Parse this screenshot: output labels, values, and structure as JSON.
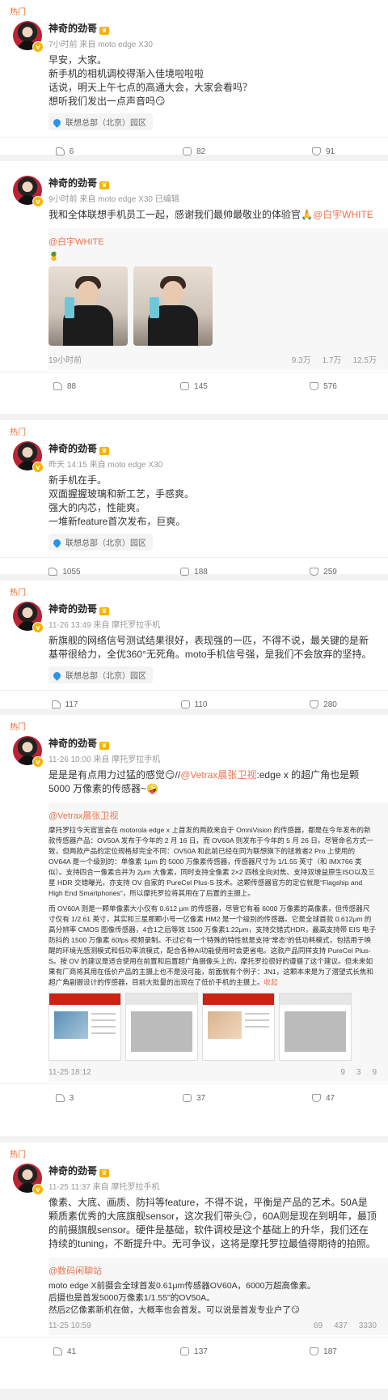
{
  "posts": [
    {
      "hot": "热门",
      "name": "神奇的劲哥",
      "meta": "7小时前 来自 moto edge X30",
      "text": [
        "早安，大家。",
        "新手机的相机调校得渐入佳境啦啦啦",
        "话说，明天上午七点的高通大会，大家会看吗？",
        "想听我们发出一点声音吗😏"
      ],
      "location": "联想总部（北京）园区",
      "shares": "6",
      "comments": "82",
      "likes": "91"
    },
    {
      "hot": "",
      "name": "神奇的劲哥",
      "meta": "9小时前 来自 moto edge X30 已编辑",
      "text_prefix": "我和全体联想手机员工一起，感谢我们最帅最敬业的体验官🙏",
      "text_link": "@白宇WHITE",
      "repost": {
        "name": "@白宇WHITE",
        "text": "🍍",
        "time": "19小时前",
        "shares": "9.3万",
        "comments": "1.7万",
        "likes": "12.5万"
      },
      "shares": "88",
      "comments": "145",
      "likes": "576"
    },
    {
      "hot": "热门",
      "name": "神奇的劲哥",
      "meta": "昨天 14:15 来自 moto edge X30",
      "text": [
        "新手机在手。",
        "双面握握玻璃和新工艺，手感爽。",
        "强大的内芯，性能爽。",
        "一堆新feature首次发布，巨爽。"
      ],
      "location": "联想总部（北京）园区",
      "shares": "1055",
      "comments": "188",
      "likes": "259"
    },
    {
      "hot": "热门",
      "name": "神奇的劲哥",
      "meta": "11-26 13:49 来自 摩托罗拉手机",
      "text": [
        "新旗舰的网络信号测试结果很好，表现强的一匹，不得不说，最关键的是新基带很给力，全优360°无死角。moto手机信号强，是我们不会放弃的坚持。"
      ],
      "location": "联想总部（北京）园区",
      "shares": "117",
      "comments": "110",
      "likes": "280"
    },
    {
      "hot": "热门",
      "name": "神奇的劲哥",
      "meta": "11-26 10:00 来自 摩托罗拉手机",
      "text_prefix": "是是是有点用力过猛的感觉😏//",
      "text_link": "@Vetrax晨张卫视",
      "text_suffix": ":edge x 的超广角也是颗 5000 万像素的传感器~🤪",
      "repost": {
        "name": "@Vetrax晨张卫视",
        "text": "摩托罗拉今天官宣会在 motorola edge x 上首发的两款来自于 OmniVision 的传感器，都是在今年发布的新款传感器产品：OV50A 发布于今年的 2 月 16 日，而 OV60A 则发布于今年的 5 月 26 日。尽管命名方式一致，但两款产品的定位规格却完全不同：OV50A 和此前已经在同为联想旗下的拯救者2 Pro 上使用的 OV64A 是一个级别的：单像素 1μm 的 5000 万像素传感器，传感器尺寸为 1/1.55 英寸（和 IMX766 类似）。支持四合一像素合并为 2μm 大像素，同时支持全像素 2×2 四核全向对焦、支持双增益原生ISO以及三星 HDR 交错曝光，亦支持 OV 自家的 PureCel Plus-S 技术。这颗传感器官方的定位就是“Flagship and High End Smartphones”，所以摩托罗拉将其用在了后置的主摄上。",
        "text2": "而 OV60A 则是一颗单像素大小仅有 0.612 μm 的传感器，尽管它有着 6000 万像素的高像素，但传感器尺寸仅有 1/2.61 英寸，其实和三星那颗小号一亿像素 HM2 是一个级别的传感器。它是全球首款 0.612μm 的高分辨率 CMOS 图像传感器，4合1之后等效 1500 万像素1.22μm，支持交错式HDR，最高支持带 EIS 电子防抖的 1500 万像素 60fps 视频录制。不过它有一个特殊的特性就是支持“常态”的低功耗模式，包括用于唤醒的环境光感测模式和低功率流模式，配合各种AI功能使用时会更省电。这款产品同样支持 PureCel Plus-S。按 OV 的建议是适合使用在前置和后置超广角摄像头上的，摩托罗拉很好的遵循了这个建议。但未来如果有厂商将其用在低价产品的主摄上也不是没可能，前面就有个例子：JN1，这颗本来是为了潜望式长焦和超广角副摄设计的传感器，目前大批量的出现在了低价手机的主摄上。",
        "fold": "收起",
        "time": "11-25 18:12",
        "shares": "9",
        "comments": "3",
        "likes": "9"
      },
      "shares": "3",
      "comments": "37",
      "likes": "47"
    },
    {
      "hot": "热门",
      "name": "神奇的劲哥",
      "meta": "11-25 11:37 来自 摩托罗拉手机",
      "text": [
        "像素、大底、画质、防抖等feature，不得不说，平衡是产品的艺术。50A是颗质素优秀的大底旗舰sensor，这次我们带头😏，60A则是现在到明年，最顶的前摄旗舰sensor。硬件是基础，软件调校是这个基础上的升华，我们还在持续的tuning，不断提升中。无可争议，这将是摩托罗拉最值得期待的拍照。"
      ],
      "repost": {
        "name": "@数码闲聊站",
        "text": "moto edge X前摄会全球首发0.61μm传感器OV60A，6000万超高像素。",
        "text2": "后摄也是首发5000万像素1/1.55\"的OV50A。",
        "text3": "然后2亿像素新机在做，大概率也会首发。可以说是首发专业户了😏",
        "time": "11-25 10:59",
        "shares": "69",
        "comments": "437",
        "likes": "3330"
      },
      "shares": "41",
      "comments": "137",
      "likes": "187"
    }
  ]
}
